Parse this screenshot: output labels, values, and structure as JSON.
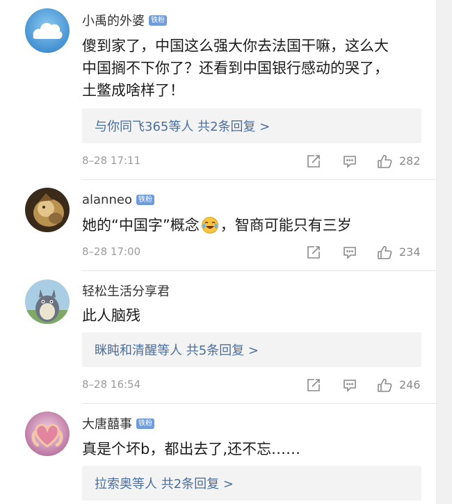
{
  "comments": [
    {
      "username": "小禹的外婆",
      "badge": "铁粉",
      "text_lines": [
        "傻到家了，中国这么强大你去法国干嘛，这么大",
        "中国搁不下你了？还看到中国银行感动的哭了，",
        "土鳖成啥样了！"
      ],
      "reply": "与你同飞365等人  共2条回复 >",
      "timestamp": "8–28 17:11",
      "likes": "282"
    },
    {
      "username": "alanneo",
      "badge": "铁粉",
      "text_before_emoji": "她的“中国字”概念",
      "emoji": "laugh-cry-emoji",
      "text_after_emoji": "，智商可能只有三岁",
      "timestamp": "8–28 17:00",
      "likes": "234"
    },
    {
      "username": "轻松生活分享君",
      "text_lines": [
        "此人脑残"
      ],
      "reply": "眯盹和清醒等人  共5条回复 >",
      "timestamp": "8–28 16:54",
      "likes": "246"
    },
    {
      "username": "大唐囍事",
      "badge": "铁粉",
      "text_lines": [
        "真是个坏b，都出去了,还不忘……"
      ],
      "reply": "拉索奥等人  共2条回复 >"
    }
  ],
  "colors": {
    "badge": "#6f9bd8",
    "reply_link": "#4a6f9d",
    "reply_bg": "#f3f3f3",
    "meta": "#9b9b9b"
  },
  "icons": [
    "repost-icon",
    "comment-icon",
    "like-icon"
  ]
}
